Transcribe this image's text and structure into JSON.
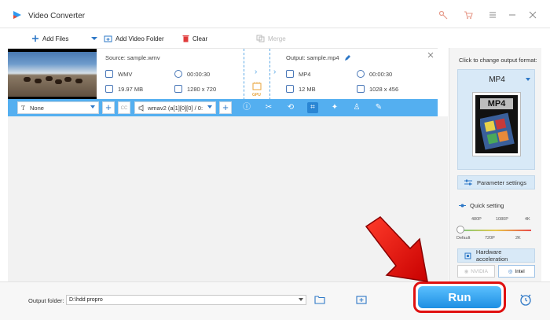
{
  "window": {
    "title": "Video Converter",
    "controls": [
      "key-icon",
      "cart-icon",
      "menu-icon",
      "minimize-icon",
      "close-icon"
    ]
  },
  "toolbar": {
    "add_files": "Add Files",
    "add_video_folder": "Add Video Folder",
    "clear": "Clear",
    "merge": "Merge"
  },
  "file": {
    "source_label": "Source: sample.wmv",
    "source_format": "WMV",
    "source_duration": "00:00:30",
    "source_size": "19.97 MB",
    "source_resolution": "1280 x 720",
    "output_label": "Output: sample.mp4",
    "output_format": "MP4",
    "output_duration": "00:00:30",
    "output_size": "12 MB",
    "output_resolution": "1028 x 456",
    "gpu_badge": "GPU"
  },
  "editbar": {
    "subtitle_value": "None",
    "audio_value": "wmav2 (a[1][0][0] / 0:",
    "cc_label": "CC"
  },
  "right_panel": {
    "change_label": "Click to change output format:",
    "format_name": "MP4",
    "format_tag": "MP4",
    "param_settings": "Parameter settings",
    "quick_setting": "Quick setting",
    "ticks_top": [
      "480P",
      "1080P",
      "4K"
    ],
    "ticks_bottom": [
      "Default",
      "720P",
      "2K"
    ],
    "hw_accel": "Hardware acceleration",
    "nvidia": "NVIDIA",
    "intel": "Intel"
  },
  "bottom": {
    "output_folder_label": "Output folder:",
    "output_folder_value": "D:\\hdd propro",
    "run_label": "Run"
  },
  "colors": {
    "accent_blue": "#54aff0",
    "run_blue": "#1e8fe3",
    "highlight_red": "#e01010"
  }
}
